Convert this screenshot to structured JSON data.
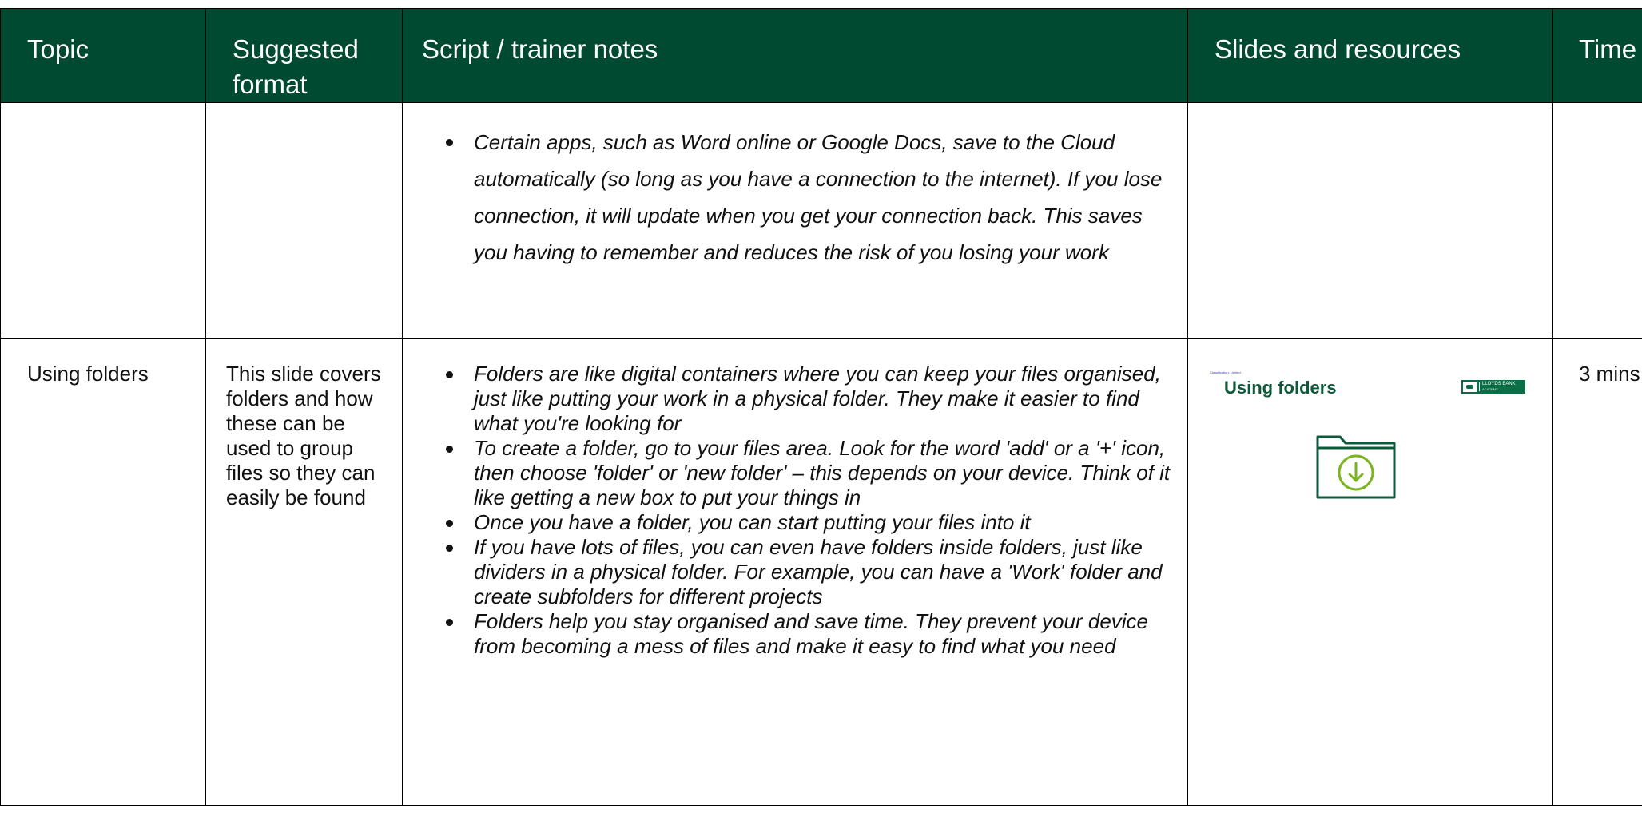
{
  "header": {
    "topic": "Topic",
    "format": "Suggested format",
    "script": "Script / trainer notes",
    "slides": "Slides and resources",
    "time": "Time"
  },
  "rows": [
    {
      "topic": "",
      "format": "",
      "notes": [
        "Certain apps, such as Word online or Google Docs, save to the Cloud automatically (so long as you have a connection to the internet). If you lose connection, it will update when you get your connection back. This saves you having to remember and reduces the risk of you losing your work"
      ],
      "time": ""
    },
    {
      "topic": "Using folders",
      "format": "This slide covers folders and how these can be used to group files so they can easily be found",
      "notes": [
        "Folders are like digital containers where you can keep your files organised, just like putting your work in a physical folder. They make it easier to find what you're looking for",
        "To create a folder, go to your files area. Look for the word 'add' or a '+' icon, then choose 'folder' or 'new folder' – this depends on your device. Think of it like getting a new box to put your things in",
        "Once you have a folder, you can start putting your files into it",
        "If you have lots of files, you can even have folders inside folders, just like dividers in a physical folder. For example, you can have a 'Work' folder and create subfolders for different projects",
        "Folders help you stay organised and save time. They prevent your device from becoming a mess of files and make it easy to find what you need"
      ],
      "slide": {
        "classification": "Classification: Limited",
        "title": "Using folders",
        "logo_text": "LLOYDS BANK",
        "logo_sub": "ACADEMY",
        "icon": "folder-download-icon",
        "accent_color": "#0b5a3a",
        "icon_color": "#7ab51d"
      },
      "time": "3 mins"
    }
  ],
  "colors": {
    "header_bg": "#004a32",
    "header_text": "#ffffff",
    "border": "#000000"
  }
}
